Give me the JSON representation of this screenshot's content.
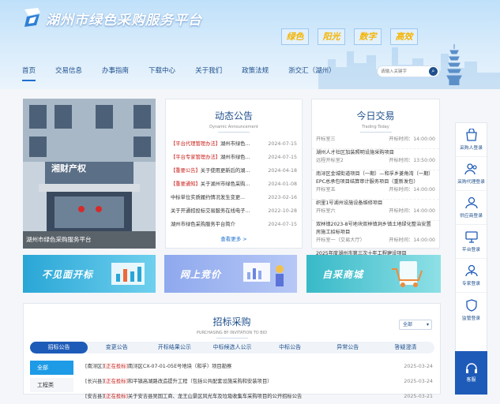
{
  "header": {
    "title": "湖州市绿色采购服务平台",
    "slogans": [
      "绿色",
      "阳光",
      "数字",
      "高效"
    ]
  },
  "nav": [
    "首页",
    "交易信息",
    "办事指南",
    "下载中心",
    "关于我们",
    "政策法规",
    "浙交汇（湖州）"
  ],
  "search": {
    "placeholder": "请输入关键字"
  },
  "photo": {
    "sign": "湘财产权",
    "caption": "湖州市绿色采购服务平台"
  },
  "news": {
    "title": "动态公告",
    "subtitle": "Dynamic Announcement",
    "items": [
      {
        "tag": "【平台代理管理办法】",
        "text": "湖州市绿色...",
        "date": "2024-07-15"
      },
      {
        "tag": "【平台专家管理办法】",
        "text": "湖州市绿色...",
        "date": "2024-07-15"
      },
      {
        "tag": "【重要公告】",
        "text": "关于使用更新后的湖...",
        "date": "2024-04-18"
      },
      {
        "tag": "【重要通知】",
        "text": "关于湖州市绿色采购...",
        "date": "2024-01-08"
      },
      {
        "tag": "",
        "text": "中标单位实质履约情况发生变更...",
        "date": "2023-02-16"
      },
      {
        "tag": "",
        "text": "关于开通招投标交易服务在线电子...",
        "date": "2022-10-28"
      },
      {
        "tag": "",
        "text": "湖州市绿色采购服务平台简介",
        "date": "2024-07-15"
      }
    ],
    "more": "查看更多 >"
  },
  "trade": {
    "title": "今日交易",
    "subtitle": "Trading Today",
    "items": [
      {
        "name": "",
        "loc": "开标室三",
        "time": "14:00:00"
      },
      {
        "name": "湖州人才社区加装照明设施采购项目",
        "loc": "远程开标室2",
        "time": "13:50:00"
      },
      {
        "name": "南浔区金城街道项目（一期）—和孚乡菱角湾（一期）EPC总承包项目结算审计服务项目（重新发包）",
        "loc": "开标室五",
        "time": "14:00:00"
      },
      {
        "name": "织里1号湖州设施设备维修项目",
        "loc": "开标室六",
        "time": "14:00:00"
      },
      {
        "name": "双林镇2023-8号地块双林镇洞乡镇土地绿化整治安置房施工招标项目",
        "loc": "开标室一（交易大厅）",
        "time": "14:00:00"
      },
      {
        "name": "2025年度湖州市第三次十年工程建设项目",
        "loc": "",
        "time": ""
      }
    ]
  },
  "sidebar": [
    "采购人登录",
    "采购代理登录",
    "供应商登录",
    "平台登录",
    "专家登录",
    "监管登录"
  ],
  "kefu": "客服",
  "banners": [
    "不见面开标",
    "网上竞价",
    "自采商城"
  ],
  "bid": {
    "title": "招标采购",
    "subtitle": "PURCHASING BY INVITATION TO BID",
    "filter": "全部",
    "tabs": [
      "招标公告",
      "变更公告",
      "开标结果公示",
      "中标候选人公示",
      "中标公告",
      "异常公告",
      "答疑澄清"
    ],
    "categories": [
      "全部",
      "工程类"
    ],
    "items": [
      {
        "region": "[南浔区]",
        "status": "[正在投标]",
        "text": "南浔区CX-07-01-05E号地块（和孚）项目勘察",
        "date": "2025-03-24"
      },
      {
        "region": "[长兴县]",
        "status": "[正在投标]",
        "text": "和平镇高湖路改造提升工程（包括公共配套设施采购和安装项目）",
        "date": "2025-03-24"
      },
      {
        "region": "[安吉县]",
        "status": "[正在投标]",
        "text": "关于安吉县吴国工商、龙王山景区风光车及垃圾收集车采购项目的公开招标公告",
        "date": "2025-03-21"
      }
    ]
  },
  "colors": {
    "primary": "#1e5bb8",
    "nav_text": "#1e4f8c",
    "accent_red": "#c8201b",
    "slogan_gold": "#f5b400"
  }
}
